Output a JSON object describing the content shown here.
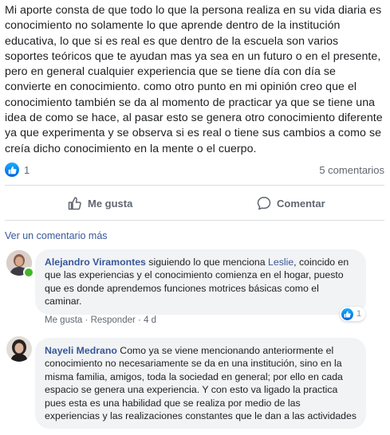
{
  "post": {
    "text": "Mi aporte consta de que todo lo que la persona realiza en su vida diaria es conocimiento no solamente lo que aprende dentro de la institución educativa, lo que si es real es que dentro de la escuela son varios soportes teóricos que te ayudan mas ya sea en un futuro o en el presente, pero en general cualquier experiencia que se tiene día con día se convierte en conocimiento. como otro punto en mi opinión creo que el conocimiento también se da al momento de practicar ya que se tiene una idea de como se hace, al pasar esto se genera otro conocimiento diferente ya que experimenta y se observa si es real o tiene sus cambios a como se creía dicho conocimiento en la mente o el cuerpo.",
    "like_count": "1",
    "comment_count": "5 comentarios"
  },
  "actions": {
    "like_label": "Me gusta",
    "comment_label": "Comentar"
  },
  "more_comments": "Ver un comentario más",
  "comments": [
    {
      "author": "Alejandro Viramontes",
      "text_before": " siguiendo lo que menciona ",
      "mention": "Leslie",
      "text_after": ", coincido en que las experiencias y el conocimiento comienza en el hogar, puesto que es donde aprendemos funciones motrices básicas como el caminar.",
      "like_label": "Me gusta",
      "reply_label": "Responder",
      "time": "4 d",
      "reaction_count": "1",
      "separator": "·"
    },
    {
      "author": "Nayeli Medrano",
      "text": " Como ya se viene mencionando anteriormente el conocimiento no necesariamente se da en una institución, sino en la misma familia, amigos, toda la sociedad en general; por ello en cada espacio se genera una experiencia. Y con esto va ligado la practica pues esta es una habilidad que se realiza por medio de las experiencias y las realizaciones constantes que le dan a las actividades"
    }
  ],
  "colors": {
    "link": "#385898",
    "secondary_text": "#606770",
    "bubble_bg": "#f2f3f5",
    "like_blue": "#1877f2",
    "online_green": "#42b72a"
  }
}
